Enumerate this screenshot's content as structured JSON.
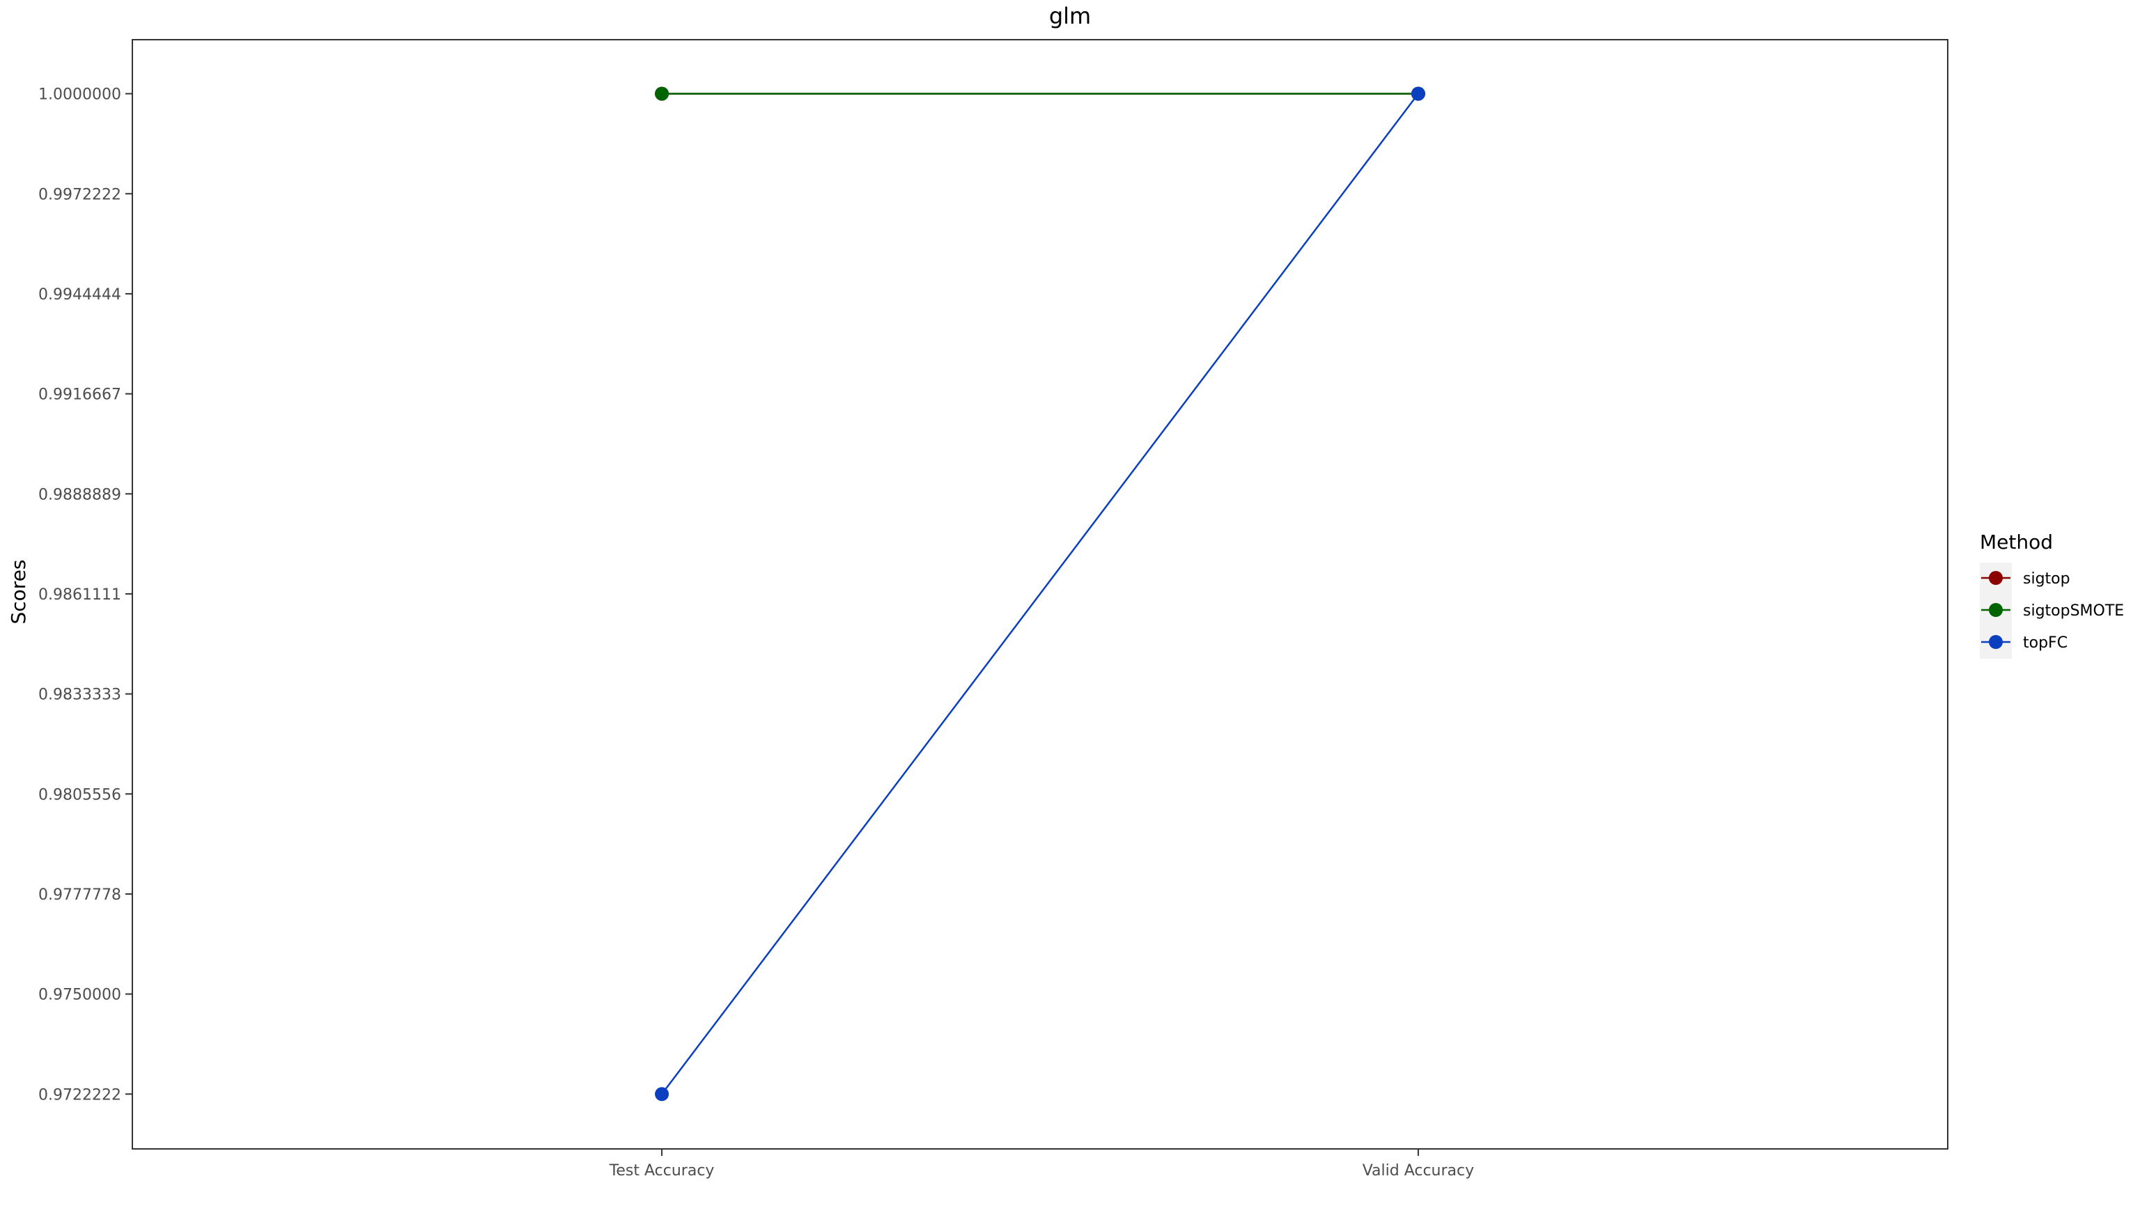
{
  "chart_data": {
    "type": "line",
    "title": "glm",
    "xlabel": "",
    "ylabel": "Scores",
    "categories": [
      "Test Accuracy",
      "Valid Accuracy"
    ],
    "ylim": [
      0.9707,
      1.0015
    ],
    "yticks": [
      "0.9722222",
      "0.9750000",
      "0.9777778",
      "0.9805556",
      "0.9833333",
      "0.9861111",
      "0.9888889",
      "0.9916667",
      "0.9944444",
      "0.9972222",
      "1.0000000"
    ],
    "grid": false,
    "legend": {
      "title": "Method",
      "position": "right"
    },
    "series": [
      {
        "name": "sigtop",
        "color": "#8b0000",
        "values": [
          1.0,
          1.0
        ]
      },
      {
        "name": "sigtopSMOTE",
        "color": "#006400",
        "values": [
          1.0,
          1.0
        ]
      },
      {
        "name": "topFC",
        "color": "#0a3fbf",
        "values": [
          0.9722222,
          1.0
        ]
      }
    ]
  }
}
